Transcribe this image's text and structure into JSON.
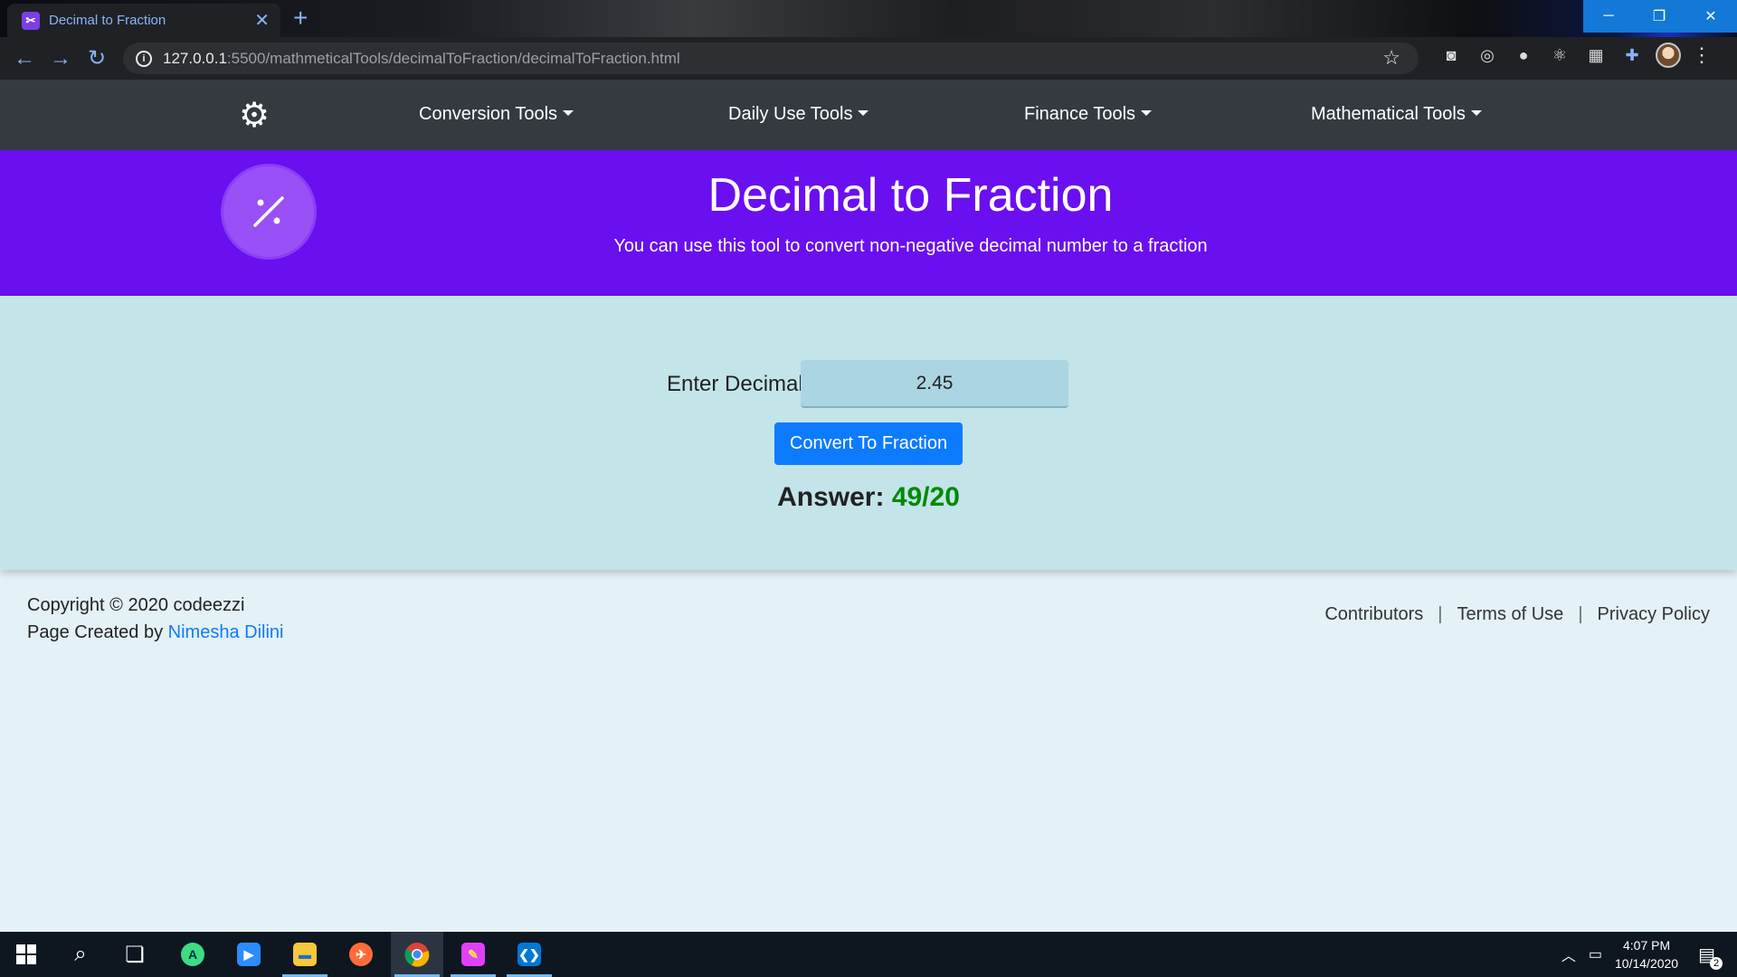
{
  "browser": {
    "tab_title": "Decimal to Fraction",
    "url_host": "127.0.0.1",
    "url_path": ":5500/mathmeticalTools/decimalToFraction/decimalToFraction.html"
  },
  "nav": {
    "items": [
      {
        "label": "Conversion Tools"
      },
      {
        "label": "Daily Use Tools"
      },
      {
        "label": "Finance Tools"
      },
      {
        "label": "Mathematical Tools"
      }
    ]
  },
  "hero": {
    "title": "Decimal to Fraction",
    "subtitle": "You can use this tool to convert non-negative decimal number to a fraction"
  },
  "tool": {
    "input_label": "Enter Decimal",
    "input_value": "2.45",
    "button_label": "Convert To Fraction",
    "answer_label": "Answer:",
    "answer_value": "49/20"
  },
  "footer": {
    "copyright": "Copyright © 2020 codeezzi",
    "created_by_prefix": "Page Created by",
    "author": "Nimesha Dilini",
    "links": [
      "Contributors",
      "Terms of Use",
      "Privacy Policy"
    ],
    "separator": "|"
  },
  "taskbar": {
    "time": "4:07 PM",
    "date": "10/14/2020",
    "notification_count": "2"
  },
  "colors": {
    "hero_bg": "#6a0ff0",
    "navbar_bg": "#343a40",
    "tool_bg": "#c3e4e9",
    "button_bg": "#0d7bfd",
    "answer_color": "#008a00"
  }
}
